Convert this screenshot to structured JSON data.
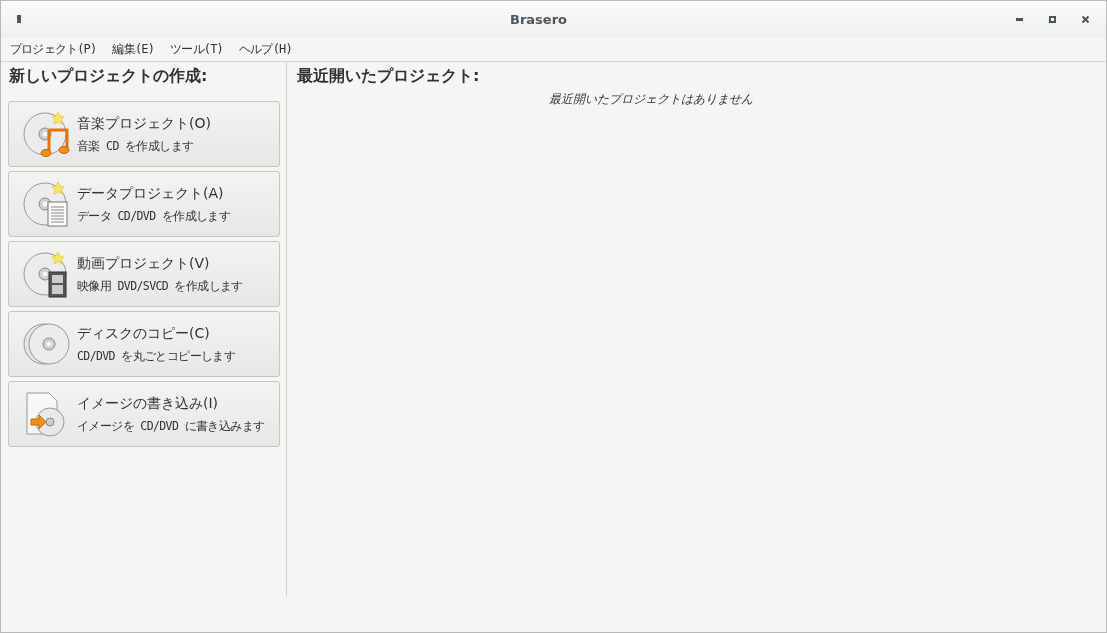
{
  "window": {
    "title": "Brasero"
  },
  "menu": [
    "プロジェクト(P)",
    "編集(E)",
    "ツール(T)",
    "ヘルプ(H)"
  ],
  "new_project": {
    "heading": "新しいプロジェクトの作成:",
    "items": [
      {
        "kind": "music",
        "title": "音楽プロジェクト(O)",
        "description": "音楽 CD を作成します"
      },
      {
        "kind": "data",
        "title": "データプロジェクト(A)",
        "description": "データ CD/DVD を作成します"
      },
      {
        "kind": "video",
        "title": "動画プロジェクト(V)",
        "description": "映像用 DVD/SVCD を作成します"
      },
      {
        "kind": "copy",
        "title": "ディスクのコピー(C)",
        "description": "CD/DVD を丸ごとコピーします"
      },
      {
        "kind": "image",
        "title": "イメージの書き込み(I)",
        "description": "イメージを CD/DVD に書き込みます"
      }
    ]
  },
  "recent": {
    "heading": "最近開いたプロジェクト:",
    "empty_message": "最近開いたプロジェクトはありません"
  }
}
